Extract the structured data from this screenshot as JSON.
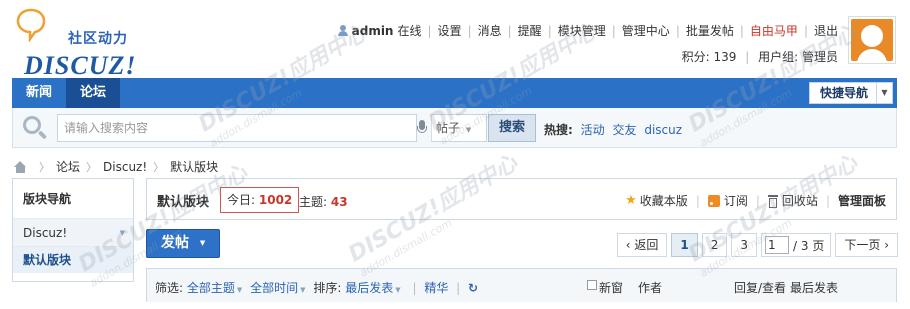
{
  "logo": {
    "cn": "社区动力",
    "en": "DISCUZ!"
  },
  "topnav": {
    "username": "admin",
    "status": "在线",
    "links": [
      {
        "label": "设置",
        "red": false
      },
      {
        "label": "消息",
        "red": false
      },
      {
        "label": "提醒",
        "red": false
      },
      {
        "label": "模块管理",
        "red": false
      },
      {
        "label": "管理中心",
        "red": false
      },
      {
        "label": "批量发帖",
        "red": false
      },
      {
        "label": "自由马甲",
        "red": true
      },
      {
        "label": "退出",
        "red": false
      }
    ],
    "credits": "积分: 139",
    "usergroup": "用户组: 管理员"
  },
  "navbar": {
    "items": [
      {
        "label": "新闻",
        "active": false
      },
      {
        "label": "论坛",
        "active": true
      }
    ],
    "quicknav": "快捷导航"
  },
  "search": {
    "placeholder": "请输入搜索内容",
    "type": "帖子",
    "button": "搜索",
    "hot_label": "热搜:",
    "hot": [
      "活动",
      "交友",
      "discuz"
    ]
  },
  "breadcrumb": [
    "论坛",
    "Discuz!",
    "默认版块"
  ],
  "forum_nav": {
    "title": "版块导航",
    "group": "Discuz!",
    "item": "默认版块"
  },
  "forum": {
    "name": "默认版块",
    "today_label": "今日:",
    "today_value": "1002",
    "threads_label": "主题:",
    "threads_value": "43",
    "actions": {
      "favorite": "收藏本版",
      "subscribe": "订阅",
      "recycle": "回收站",
      "manage": "管理面板"
    }
  },
  "post_button": "发帖",
  "pager": {
    "prev": "返回",
    "pages": [
      "1",
      "2",
      "3"
    ],
    "current": "1",
    "input_value": "1",
    "total": "/ 3 页",
    "next": "下一页"
  },
  "filter": {
    "label": "筛选:",
    "all_threads": "全部主题",
    "all_time": "全部时间",
    "sort_label": "排序:",
    "sort_value": "最后发表",
    "digest": "精华",
    "new_window": "新窗",
    "author": "作者",
    "reply_view": "回复/查看",
    "last_post": "最后发表"
  },
  "watermark": {
    "main": "DISCUZ!应用中心",
    "sub": "addon.dismall.com"
  }
}
